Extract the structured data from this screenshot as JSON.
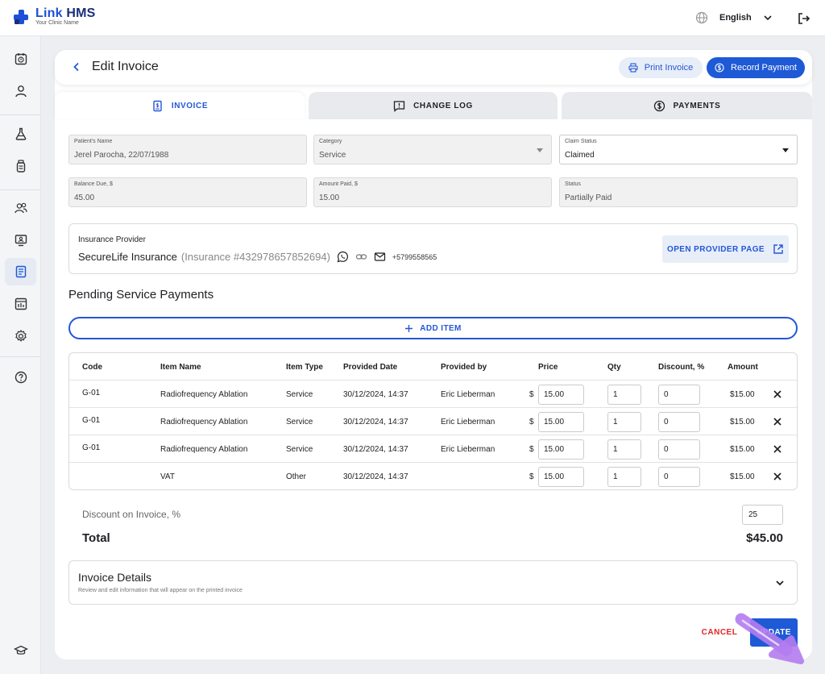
{
  "app": {
    "name_a": "Link",
    "name_b": "HMS",
    "subtitle": "Your Clinic Name",
    "language": "English"
  },
  "header": {
    "title": "Edit Invoice",
    "print_label": "Print Invoice",
    "record_label": "Record Payment"
  },
  "tabs": [
    {
      "label": "INVOICE",
      "icon": "invoice-icon"
    },
    {
      "label": "CHANGE LOG",
      "icon": "comment-alert-icon"
    },
    {
      "label": "PAYMENTS",
      "icon": "dollar-circle-icon"
    }
  ],
  "form": {
    "patient": {
      "label": "Patient's Name",
      "value": "Jerel Parocha, 22/07/1988"
    },
    "category": {
      "label": "Category",
      "value": "Service"
    },
    "claim_status": {
      "label": "Claim Status",
      "value": "Claimed"
    },
    "balance_due": {
      "label": "Balance Due, $",
      "value": "45.00"
    },
    "amount_paid": {
      "label": "Amount Paid, $",
      "value": "15.00"
    },
    "status": {
      "label": "Status",
      "value": "Partially Paid"
    }
  },
  "insurance": {
    "title": "Insurance Provider",
    "provider": "SecureLife Insurance",
    "number": "(Insurance #432978657852694)",
    "phone": "+5799558565",
    "open_label": "OPEN PROVIDER PAGE"
  },
  "pending": {
    "title": "Pending Service Payments",
    "add_label": "ADD ITEM"
  },
  "table": {
    "headers": [
      "Code",
      "Item Name",
      "Item Type",
      "Provided Date",
      "Provided by",
      "Price",
      "Qty",
      "Discount, %",
      "Amount"
    ],
    "currency": "$",
    "rows": [
      {
        "code": "G-01",
        "name": "Radiofrequency Ablation",
        "type": "Service",
        "date": "30/12/2024, 14:37",
        "by": "Eric Lieberman",
        "price": "15.00",
        "qty": "1",
        "discount": "0",
        "amount": "$15.00"
      },
      {
        "code": "G-01",
        "name": "Radiofrequency Ablation",
        "type": "Service",
        "date": "30/12/2024, 14:37",
        "by": "Eric Lieberman",
        "price": "15.00",
        "qty": "1",
        "discount": "0",
        "amount": "$15.00"
      },
      {
        "code": "G-01",
        "name": "Radiofrequency Ablation",
        "type": "Service",
        "date": "30/12/2024, 14:37",
        "by": "Eric Lieberman",
        "price": "15.00",
        "qty": "1",
        "discount": "0",
        "amount": "$15.00"
      },
      {
        "code": "",
        "name": "VAT",
        "type": "Other",
        "date": "30/12/2024, 14:37",
        "by": "",
        "price": "15.00",
        "qty": "1",
        "discount": "0",
        "amount": "$15.00"
      }
    ]
  },
  "summary": {
    "discount_label": "Discount on Invoice, %",
    "discount_value": "25",
    "total_label": "Total",
    "total_value": "$45.00"
  },
  "details": {
    "title": "Invoice Details",
    "subtitle": "Review and edit information that will appear on the printed invoice"
  },
  "actions": {
    "cancel": "CANCEL",
    "update": "UPDATE"
  }
}
